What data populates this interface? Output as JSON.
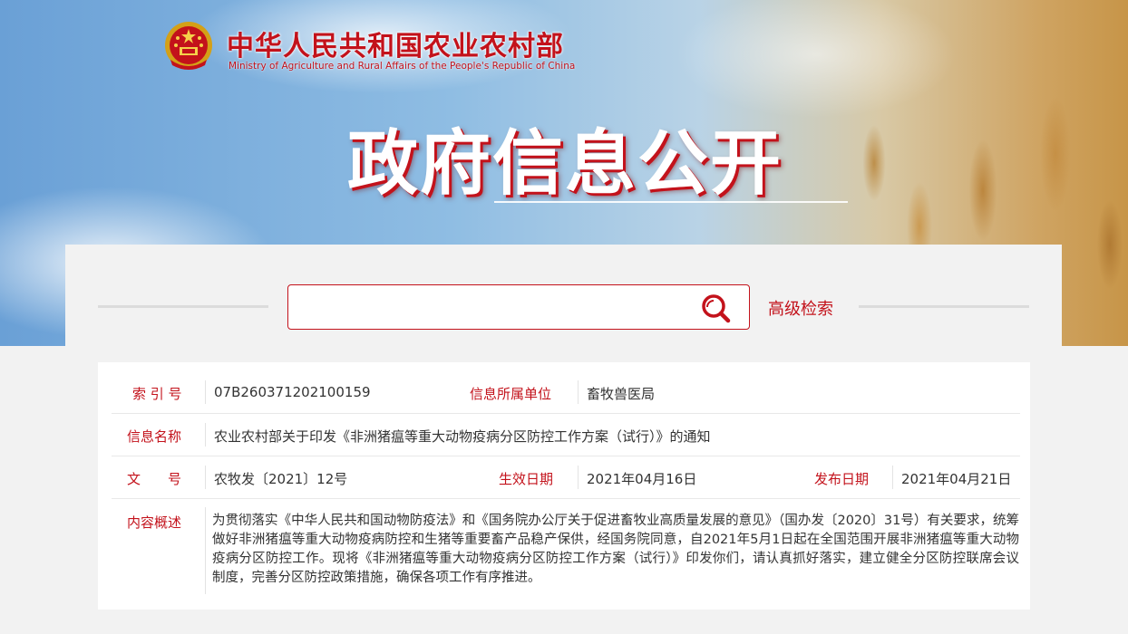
{
  "header": {
    "site_title": "中华人民共和国农业农村部",
    "site_subtitle": "Ministry of Agriculture and Rural Affairs of the People's Republic of China",
    "banner_title": "政府信息公开",
    "emblem_icon": "national-emblem-icon"
  },
  "search": {
    "placeholder": "",
    "advanced_label": "高级检索",
    "icon": "search-icon"
  },
  "info": {
    "index_label": "索 引 号",
    "index_value": "07B260371202100159",
    "unit_label": "信息所属单位",
    "unit_value": "畜牧兽医局",
    "name_label": "信息名称",
    "name_value": "农业农村部关于印发《非洲猪瘟等重大动物疫病分区防控工作方案（试行）》的通知",
    "docno_label": "文　　号",
    "docno_value": "农牧发〔2021〕12号",
    "effective_label": "生效日期",
    "effective_value": "2021年04月16日",
    "publish_label": "发布日期",
    "publish_value": "2021年04月21日",
    "summary_label": "内容概述",
    "summary_value": "为贯彻落实《中华人民共和国动物防疫法》和《国务院办公厅关于促进畜牧业高质量发展的意见》（国办发〔2020〕31号）有关要求，统筹做好非洲猪瘟等重大动物疫病防控和生猪等重要畜产品稳产保供，经国务院同意，自2021年5月1日起在全国范围开展非洲猪瘟等重大动物疫病分区防控工作。现将《非洲猪瘟等重大动物疫病分区防控工作方案（试行）》印发你们，请认真抓好落实，建立健全分区防控联席会议制度，完善分区防控政策措施，确保各项工作有序推进。"
  },
  "colors": {
    "accent": "#c3121b",
    "panel_bg": "#f2f2f2",
    "text": "#333333"
  }
}
